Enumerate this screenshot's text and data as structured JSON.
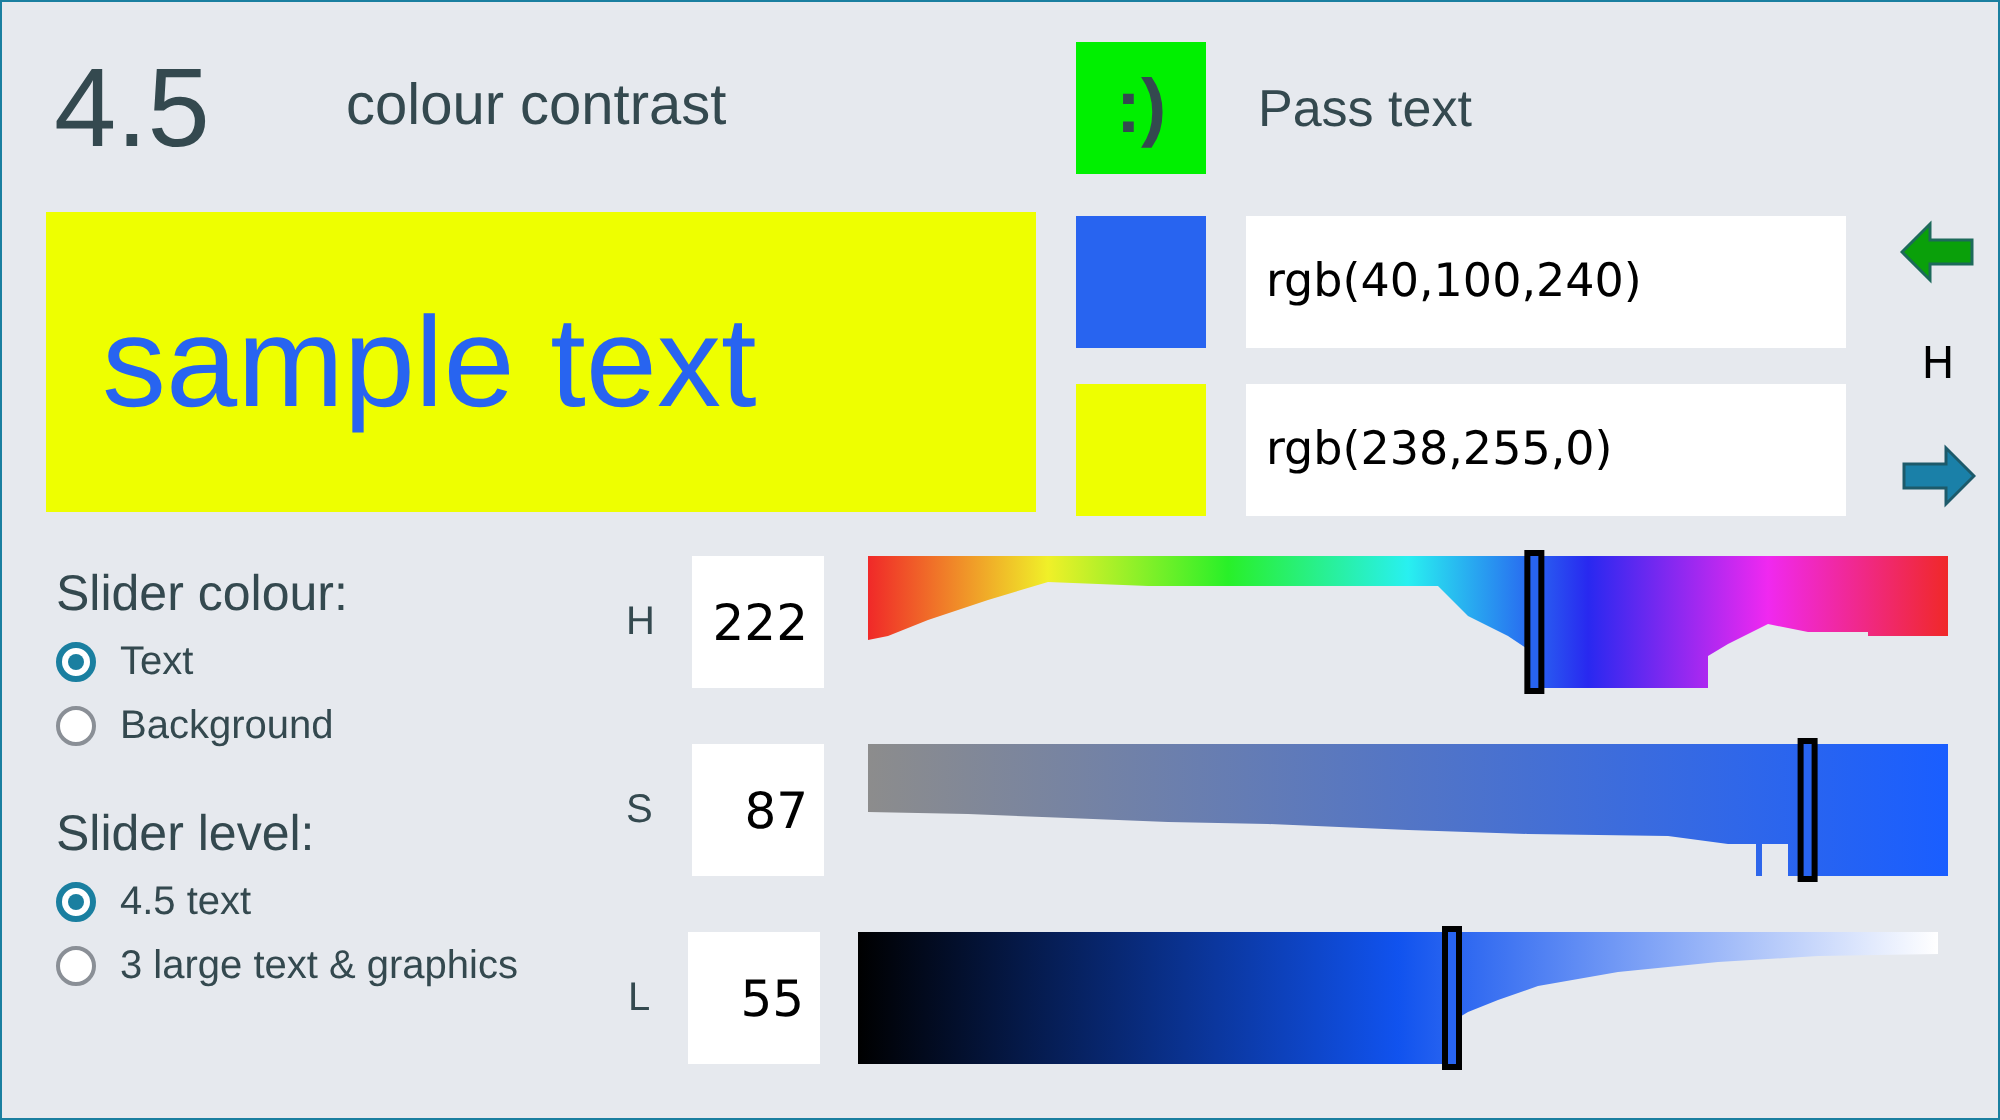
{
  "contrast": {
    "ratio": "4.5",
    "label": "colour contrast"
  },
  "result": {
    "icon": ":)",
    "label": "Pass text",
    "pass": true
  },
  "sample": {
    "text": "sample text"
  },
  "colours": [
    {
      "kind": "text",
      "color": "#2864f0",
      "value": "rgb(40,100,240)"
    },
    {
      "kind": "background",
      "color": "#eeff00",
      "value": "rgb(238,255,0)"
    }
  ],
  "swap": {
    "label": "H"
  },
  "slider_colour": {
    "title": "Slider colour:",
    "options": [
      {
        "label": "Text",
        "selected": true
      },
      {
        "label": "Background",
        "selected": false
      }
    ]
  },
  "slider_level": {
    "title": "Slider level:",
    "options": [
      {
        "label": "4.5 text",
        "selected": true
      },
      {
        "label": "3 large text & graphics",
        "selected": false
      }
    ]
  },
  "sliders": [
    {
      "kind": "hue",
      "label": "H",
      "value": "222",
      "level": 0.617
    },
    {
      "kind": "saturation",
      "label": "S",
      "value": "87",
      "level": 0.87
    },
    {
      "kind": "lightness",
      "label": "L",
      "value": "55",
      "level": 0.55
    }
  ]
}
